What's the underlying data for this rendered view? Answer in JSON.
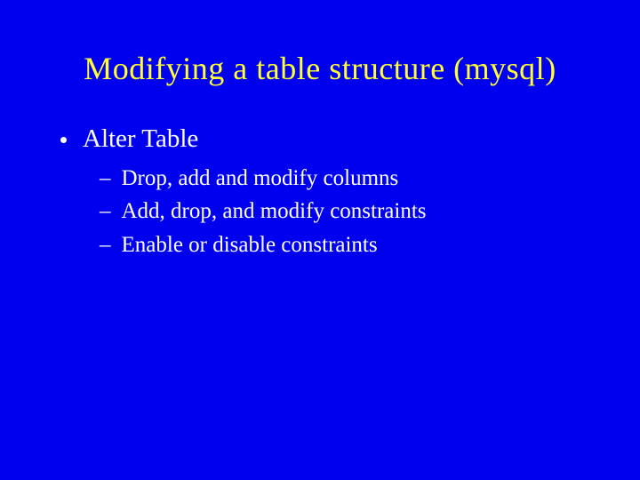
{
  "slide": {
    "title": "Modifying a table structure (mysql)",
    "bullets": {
      "main": "Alter Table",
      "sub1": "Drop, add and modify columns",
      "sub2": "Add, drop, and modify constraints",
      "sub3": "Enable or disable constraints"
    }
  }
}
